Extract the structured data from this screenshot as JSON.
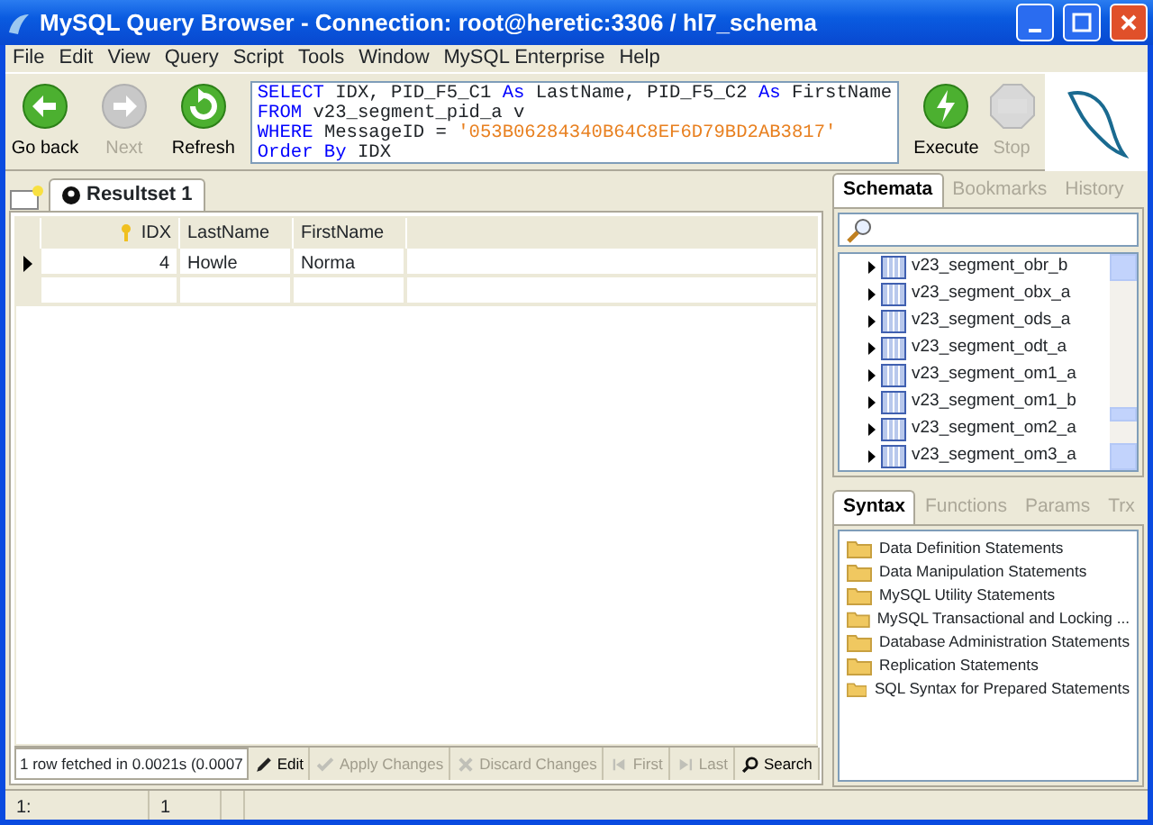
{
  "window": {
    "title": "MySQL Query Browser - Connection: root@heretic:3306 / hl7_schema"
  },
  "menu": [
    "File",
    "Edit",
    "View",
    "Query",
    "Script",
    "Tools",
    "Window",
    "MySQL Enterprise",
    "Help"
  ],
  "nav_buttons": [
    {
      "label": "Go back",
      "kind": "back",
      "disabled": false
    },
    {
      "label": "Next",
      "kind": "next",
      "disabled": true
    },
    {
      "label": "Refresh",
      "kind": "refresh",
      "disabled": false
    }
  ],
  "query": {
    "lines": [
      [
        {
          "kind": "keyword",
          "text": "SELECT"
        },
        {
          "kind": "plain",
          "text": " IDX, PID_F5_C1 "
        },
        {
          "kind": "keyword",
          "text": "As"
        },
        {
          "kind": "plain",
          "text": " LastName, PID_F5_C2 "
        },
        {
          "kind": "keyword",
          "text": "As"
        },
        {
          "kind": "plain",
          "text": " FirstName"
        }
      ],
      [
        {
          "kind": "keyword",
          "text": "FROM"
        },
        {
          "kind": "plain",
          "text": " v23_segment_pid_a v"
        }
      ],
      [
        {
          "kind": "keyword",
          "text": "WHERE"
        },
        {
          "kind": "plain",
          "text": " MessageID = "
        },
        {
          "kind": "string",
          "text": "'053B06284340B64C8EF6D79BD2AB3817'"
        }
      ],
      [
        {
          "kind": "keyword",
          "text": "Order By"
        },
        {
          "kind": "plain",
          "text": " IDX"
        }
      ]
    ]
  },
  "run_buttons": [
    {
      "label": "Execute",
      "kind": "execute",
      "disabled": false
    },
    {
      "label": "Stop",
      "kind": "stop",
      "disabled": true
    }
  ],
  "result_tabs": [
    {
      "label": "Resultset 1",
      "selected": true
    }
  ],
  "table": {
    "columns": [
      "IDX",
      "LastName",
      "FirstName"
    ],
    "rows": [
      {
        "cells": [
          "4",
          "Howle",
          "Norma"
        ],
        "current": true
      }
    ]
  },
  "result_status": "1 row fetched in 0.0021s (0.0007",
  "result_buttons": [
    {
      "label": "Edit",
      "kind": "edit",
      "disabled": false
    },
    {
      "label": "Apply Changes",
      "kind": "apply",
      "disabled": true
    },
    {
      "label": "Discard Changes",
      "kind": "discard",
      "disabled": true
    },
    {
      "label": "First",
      "kind": "first",
      "disabled": true
    },
    {
      "label": "Last",
      "kind": "last",
      "disabled": true
    },
    {
      "label": "Search",
      "kind": "search",
      "disabled": false
    }
  ],
  "browser_tabs": [
    {
      "label": "Schemata",
      "selected": true
    },
    {
      "label": "Bookmarks",
      "selected": false
    },
    {
      "label": "History",
      "selected": false
    }
  ],
  "schemata": [
    "v23_segment_obr_b",
    "v23_segment_obx_a",
    "v23_segment_ods_a",
    "v23_segment_odt_a",
    "v23_segment_om1_a",
    "v23_segment_om1_b",
    "v23_segment_om2_a",
    "v23_segment_om3_a"
  ],
  "syntax_tabs": [
    {
      "label": "Syntax",
      "selected": true
    },
    {
      "label": "Functions",
      "selected": false
    },
    {
      "label": "Params",
      "selected": false
    },
    {
      "label": "Trx",
      "selected": false
    }
  ],
  "syntax_items": [
    "Data Definition Statements",
    "Data Manipulation Statements",
    "MySQL Utility Statements",
    "MySQL Transactional and Locking ...",
    "Database Administration Statements",
    "Replication Statements",
    "SQL Syntax for Prepared Statements"
  ],
  "status_bar": [
    "1:",
    "1"
  ]
}
